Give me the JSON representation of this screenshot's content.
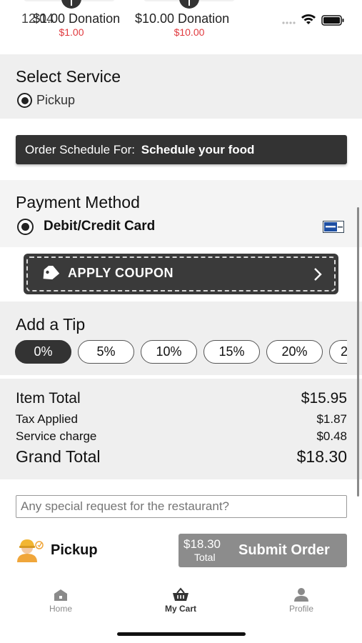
{
  "status_bar": {
    "time": "12:04"
  },
  "donations": [
    {
      "title": "$1.00 Donation",
      "price": "$1.00"
    },
    {
      "title": "$10.00 Donation",
      "price": "$10.00"
    }
  ],
  "service": {
    "title": "Select Service",
    "option": "Pickup"
  },
  "schedule": {
    "prefix": "Order Schedule For:",
    "value": "Schedule your food"
  },
  "payment": {
    "title": "Payment Method",
    "option": "Debit/Credit Card"
  },
  "coupon": {
    "label": "APPLY COUPON"
  },
  "tip": {
    "title": "Add a Tip",
    "options": [
      "0%",
      "5%",
      "10%",
      "15%",
      "20%",
      "2"
    ]
  },
  "summary": {
    "item_total_label": "Item Total",
    "item_total": "$15.95",
    "tax_label": "Tax Applied",
    "tax": "$1.87",
    "service_label": "Service charge",
    "service": "$0.48",
    "grand_label": "Grand Total",
    "grand": "$18.30"
  },
  "request": {
    "placeholder": "Any special request for the restaurant?"
  },
  "footer": {
    "mode": "Pickup",
    "total": "$18.30",
    "total_caption": "Total",
    "submit_label": "Submit Order"
  },
  "tabs": [
    {
      "label": "Home",
      "icon": "home-icon"
    },
    {
      "label": "My Cart",
      "icon": "cart-basket-icon"
    },
    {
      "label": "Profile",
      "icon": "profile-icon"
    }
  ],
  "colors": {
    "accent_dark": "#333333",
    "price_red": "#e0393e",
    "submit_grey": "#8c8c8c"
  }
}
